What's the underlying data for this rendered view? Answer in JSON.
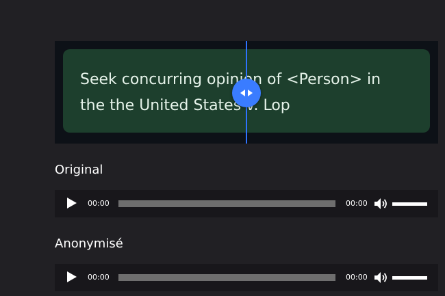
{
  "comparison": {
    "text": "Seek concurring opinion of <Person> in the the United States v. Lop",
    "handle_icon": "left-right-arrows-icon"
  },
  "players": [
    {
      "label": "Original",
      "current_time": "00:00",
      "duration": "00:00",
      "volume_icon": "speaker-icon",
      "volume_level": 1.0
    },
    {
      "label": "Anonymisé",
      "current_time": "00:00",
      "duration": "00:00",
      "volume_icon": "speaker-icon",
      "volume_level": 1.0
    }
  ],
  "colors": {
    "background": "#212024",
    "card": "#1d3f2d",
    "divider": "#2f73ff",
    "handle": "#3a7cff"
  }
}
